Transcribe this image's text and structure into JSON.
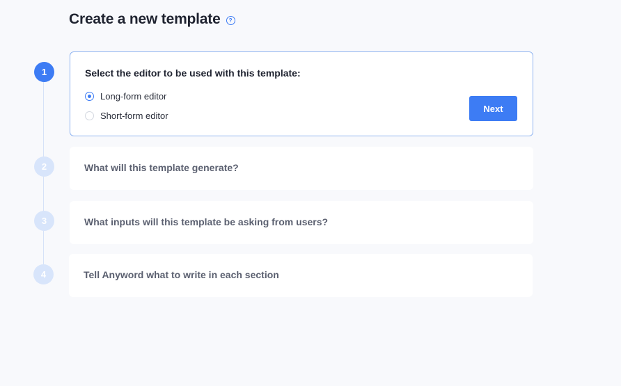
{
  "page": {
    "title": "Create a new template",
    "help_icon": "?"
  },
  "steps": [
    {
      "number": "1",
      "heading": "Select the editor to be used with this template:",
      "options": [
        {
          "label": "Long-form editor",
          "checked": true
        },
        {
          "label": "Short-form editor",
          "checked": false
        }
      ],
      "next_label": "Next"
    },
    {
      "number": "2",
      "heading": "What will this template generate?"
    },
    {
      "number": "3",
      "heading": "What inputs will this template be asking from users?"
    },
    {
      "number": "4",
      "heading": "Tell Anyword what to write in each section"
    }
  ],
  "colors": {
    "accent": "#3d7cf4",
    "inactive_step": "#d8e5fb",
    "background": "#f8f9fc"
  }
}
